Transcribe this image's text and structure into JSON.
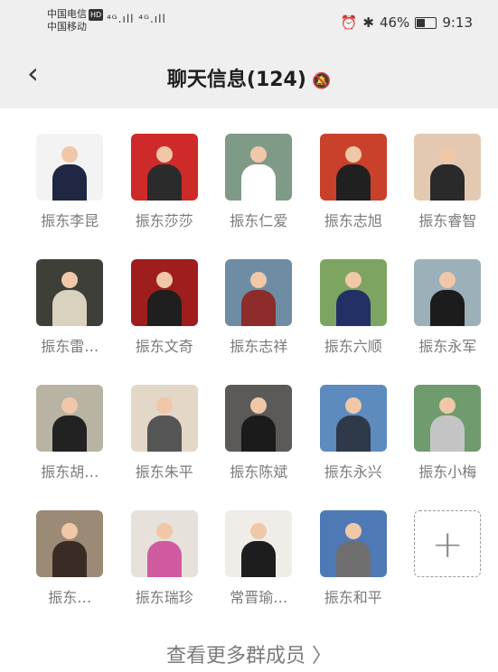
{
  "status": {
    "carrier1": "中国电信",
    "carrier_badge": "HD",
    "carrier2": "中国移动",
    "signal": "⁴ᴳ.ıll ⁴ᴳ.ıll",
    "right_text": "46%",
    "time": "9:13"
  },
  "nav": {
    "title": "聊天信息(124)"
  },
  "members": [
    {
      "name": "振东李昆",
      "bg": "#f3f3f3",
      "body": "#1f2742"
    },
    {
      "name": "振东莎莎",
      "bg": "#cf2a2a",
      "body": "#2b2b2b"
    },
    {
      "name": "振东仁爱",
      "bg": "#7f9a87",
      "body": "#ffffff"
    },
    {
      "name": "振东志旭",
      "bg": "#c9402b",
      "body": "#202020"
    },
    {
      "name": "振东睿智",
      "bg": "#e4c9b2",
      "body": "#2a2a2a"
    },
    {
      "name": "振东雷…",
      "bg": "#3d3f38",
      "body": "#d8d2bf"
    },
    {
      "name": "振东文奇",
      "bg": "#9e1d1d",
      "body": "#1f1f1f"
    },
    {
      "name": "振东志祥",
      "bg": "#6e8da5",
      "body": "#8e2b2b"
    },
    {
      "name": "振东六顺",
      "bg": "#7da460",
      "body": "#223066"
    },
    {
      "name": "振东永军",
      "bg": "#9bb0b9",
      "body": "#1c1c1c"
    },
    {
      "name": "振东胡…",
      "bg": "#b9b3a4",
      "body": "#222222"
    },
    {
      "name": "振东朱平",
      "bg": "#e3d7c8",
      "body": "#555555"
    },
    {
      "name": "振东陈斌",
      "bg": "#5c5a58",
      "body": "#1b1b1b"
    },
    {
      "name": "振东永兴",
      "bg": "#5d8bbd",
      "body": "#2e3a4a"
    },
    {
      "name": "振东小梅",
      "bg": "#6f9b6e",
      "body": "#c4c4c4"
    },
    {
      "name": "振东…",
      "bg": "#9a8a76",
      "body": "#3a2c24"
    },
    {
      "name": "振东瑞珍",
      "bg": "#e7e1dc",
      "body": "#d05aa0"
    },
    {
      "name": "常晋瑜…",
      "bg": "#f0ede9",
      "body": "#1d1d1d"
    },
    {
      "name": "振东和平",
      "bg": "#4f79b5",
      "body": "#6f6f6f"
    }
  ],
  "add_label": "+",
  "footer": {
    "more": "查看更多群成员 〉"
  },
  "icons": {
    "back": "‹",
    "mute": "🔕"
  }
}
